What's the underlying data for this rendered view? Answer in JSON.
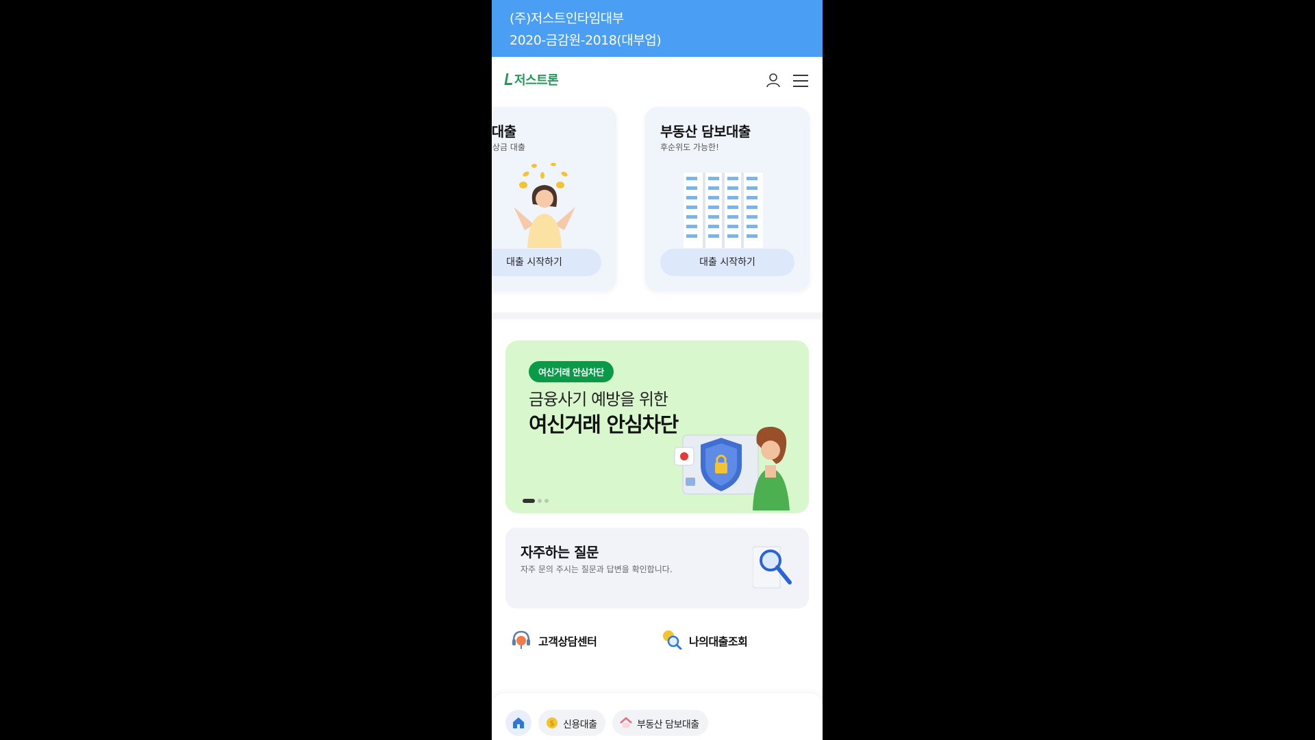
{
  "topbar": {
    "company": "(주)저스트인타임대부",
    "registration": "2020-금감원-2018(대부업)"
  },
  "header": {
    "logo": "저스트론",
    "icons": [
      "user-icon",
      "menu-icon"
    ]
  },
  "loan_cards": [
    {
      "title": "신용대출",
      "subtitle": "편한 비상금 대출",
      "button": "대출 시작하기"
    },
    {
      "title": "부동산 담보대출",
      "subtitle": "후순위도 가능한!",
      "button": "대출 시작하기"
    }
  ],
  "banner": {
    "badge": "여신거래 안심차단",
    "subtitle": "금융사기 예방을 위한",
    "title": "여신거래 안심차단",
    "slide_count": 3,
    "active_slide": 1,
    "background_color": "#d9f7cc",
    "badge_color": "#0a9a48"
  },
  "faq": {
    "title": "자주하는 질문",
    "subtitle": "자주 문의 주시는 질문과 답변을 확인합니다."
  },
  "quick_links": [
    {
      "label": "고객상담센터",
      "icon": "headset-icon"
    },
    {
      "label": "나의대출조회",
      "icon": "search-coin-icon"
    }
  ],
  "bottom_nav": {
    "home_icon": "home-icon",
    "items": [
      {
        "label": "신용대출",
        "icon": "coin-icon"
      },
      {
        "label": "부동산 담보대출",
        "icon": "house-icon"
      }
    ]
  },
  "colors": {
    "topbar": "#4a9ff5",
    "brand_green": "#1d9a55",
    "card_bg": "#f0f5fc",
    "card_button": "#dde9fb"
  }
}
